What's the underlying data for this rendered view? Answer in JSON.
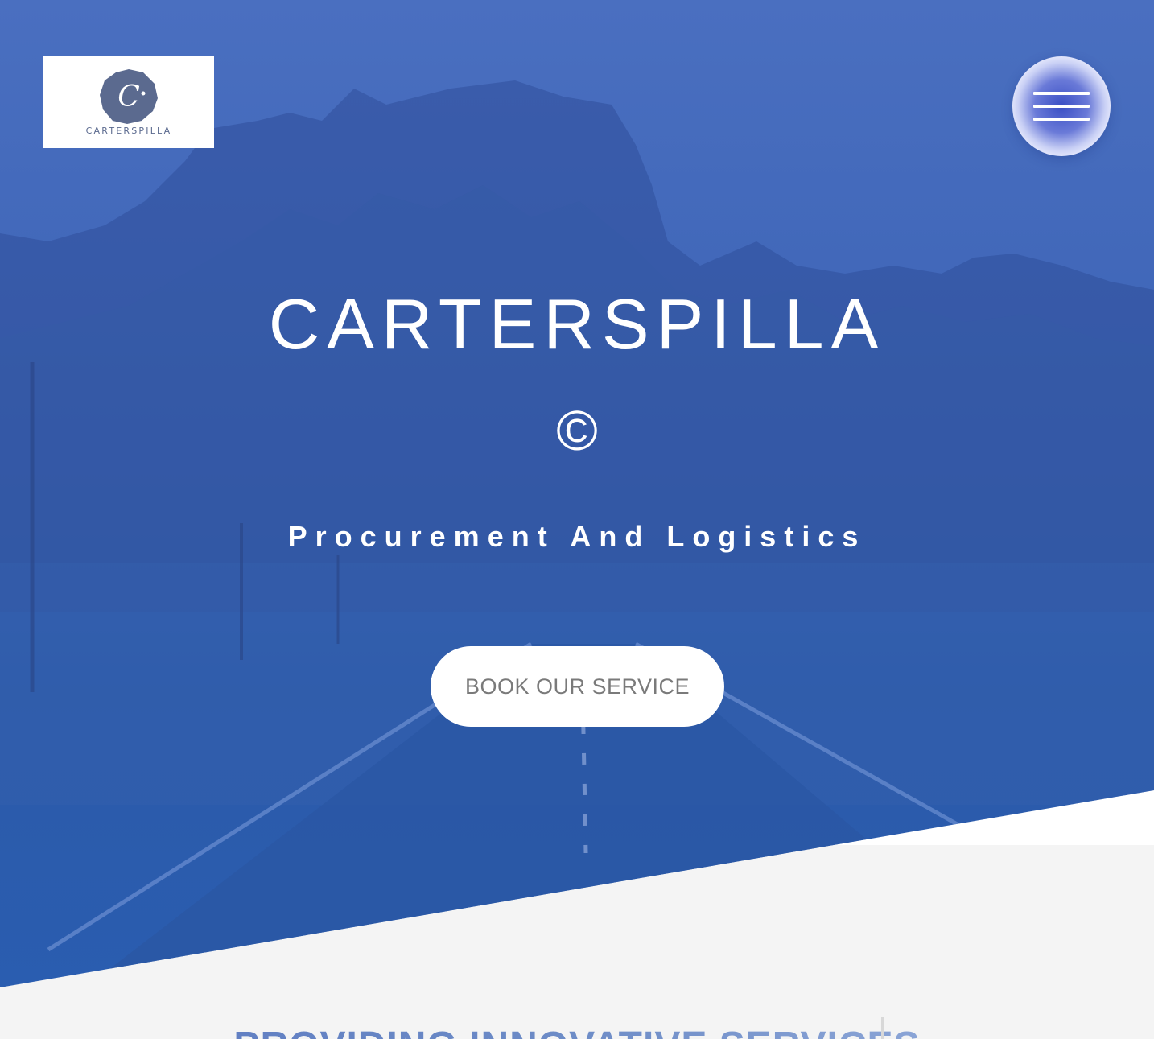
{
  "header": {
    "logo": {
      "brand_text": "CARTERSPILLA",
      "mark_letter": "C"
    },
    "menu_button": {
      "icon": "hamburger-icon"
    }
  },
  "hero": {
    "title": "CARTERSPILLA",
    "symbol": "©",
    "subtitle": "Procurement And Logistics",
    "cta_label": "BOOK OUR SERVICE"
  },
  "services": {
    "heading": "PROVIDING INNOVATIVE SERVICES"
  },
  "colors": {
    "hero_overlay": "#3f66b8",
    "logo_mark": "#5b6a8f",
    "section_bg": "#f4f4f4",
    "heading": "#6d8cc7"
  }
}
